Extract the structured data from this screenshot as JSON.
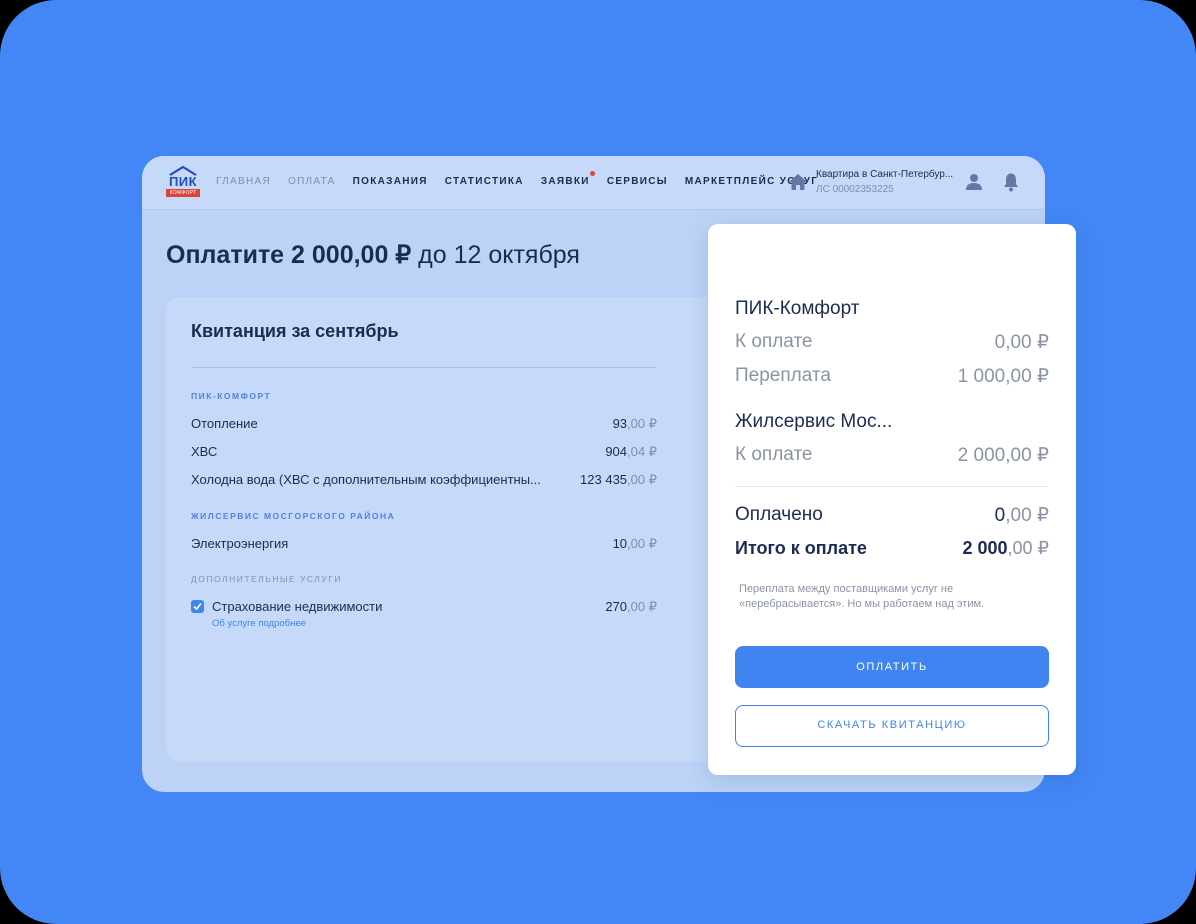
{
  "header": {
    "logo_text": "ПИК",
    "logo_sub": "КОМФОРТ",
    "nav": [
      {
        "label": "ГЛАВНАЯ",
        "state": "dim"
      },
      {
        "label": "ОПЛАТА",
        "state": "dim"
      },
      {
        "label": "ПОКАЗАНИЯ",
        "state": "normal"
      },
      {
        "label": "СТАТИСТИКА",
        "state": "normal"
      },
      {
        "label": "ЗАЯВКИ",
        "state": "normal"
      },
      {
        "label": "СЕРВИСЫ",
        "state": "normal"
      },
      {
        "label": "МАРКЕТПЛЕЙС УСЛУГ",
        "state": "normal"
      }
    ],
    "address": "Квартира в Санкт-Петербур...",
    "account": "ЛС 00002353225",
    "icons": [
      "home-icon",
      "person-icon",
      "bell-icon"
    ]
  },
  "headline": {
    "amount": "Оплатите 2 000,00 ₽",
    "due": "до 12 октября"
  },
  "receipt": {
    "title": "Квитанция за сентябрь",
    "sections": [
      {
        "name": "ПИК-КОМФОРТ",
        "items": [
          {
            "name": "Отопление",
            "int": "93",
            "frac": ",00 ₽"
          },
          {
            "name": "ХВС",
            "int": "904",
            "frac": ",04 ₽"
          },
          {
            "name": "Холодна вода (ХВС с дополнительным коэффициентны...",
            "int": "123 435",
            "frac": ",00 ₽"
          }
        ]
      },
      {
        "name": "ЖИЛСЕРВИС МОСГОРСКОГО РАЙОНА",
        "items": [
          {
            "name": "Электроэнергия",
            "int": "10",
            "frac": ",00 ₽"
          }
        ]
      },
      {
        "name": "ДОПОЛНИТЕЛЬНЫЕ УСЛУГИ",
        "items": [
          {
            "name": "Страхование недвижимости",
            "int": "270",
            "frac": ",00 ₽",
            "checked": true
          }
        ]
      }
    ],
    "more_link": "Об услуге подробнее"
  },
  "summary": {
    "provider1": "ПИК-Комфорт",
    "p1_due_label": "К оплате",
    "p1_due": "0,00 ₽",
    "p1_over_label": "Переплата",
    "p1_over": "1 000,00 ₽",
    "provider2": "Жилсервис Мос...",
    "p2_due_label": "К оплате",
    "p2_due": "2 000,00 ₽",
    "paid_label": "Оплачено",
    "paid_int": "0",
    "paid_frac": ",00 ₽",
    "total_label": "Итого к оплате",
    "total_int": "2 000",
    "total_frac": ",00 ₽",
    "note": "Переплата между поставщиками услуг не «перебрасывается». Но мы работаем над этим.",
    "pay_button": "ОПЛАТИТЬ",
    "download_button": "СКАЧАТЬ КВИТАНЦИЮ"
  },
  "colors": {
    "background": "#4287f5",
    "accent": "#3f84f0",
    "text": "#1b2c52",
    "logo_red": "#e0433a"
  }
}
